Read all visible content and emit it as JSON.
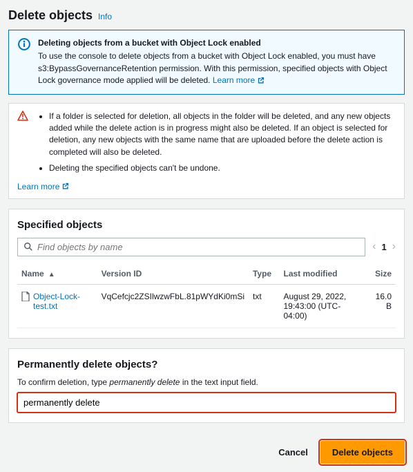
{
  "header": {
    "title": "Delete objects",
    "info": "Info"
  },
  "alert": {
    "title": "Deleting objects from a bucket with Object Lock enabled",
    "body": "To use the console to delete objects from a bucket with Object Lock enabled, you must have s3:BypassGovernanceRetention permission. With this permission, specified objects with Object Lock governance mode applied will be deleted.",
    "learn": "Learn more"
  },
  "warning": {
    "items": [
      "If a folder is selected for deletion, all objects in the folder will be deleted, and any new objects added while the delete action is in progress might also be deleted. If an object is selected for deletion, any new objects with the same name that are uploaded before the delete action is completed will also be deleted.",
      "Deleting the specified objects can't be undone."
    ],
    "learn": "Learn more"
  },
  "specified": {
    "title": "Specified objects",
    "search_placeholder": "Find objects by name",
    "page": "1",
    "columns": {
      "name": "Name",
      "version": "Version ID",
      "type": "Type",
      "modified": "Last modified",
      "size": "Size"
    },
    "rows": [
      {
        "name": "Object-Lock-test.txt",
        "version": "VqCefcjc2ZSIlwzwFbL.81pWYdKi0mSi",
        "type": "txt",
        "modified": "August 29, 2022, 19:43:00 (UTC-04:00)",
        "size": "16.0 B"
      }
    ]
  },
  "confirm": {
    "title": "Permanently delete objects?",
    "prompt_prefix": "To confirm deletion, type ",
    "phrase": "permanently delete",
    "prompt_suffix": " in the text input field.",
    "value": "permanently delete"
  },
  "footer": {
    "cancel": "Cancel",
    "delete": "Delete objects"
  }
}
